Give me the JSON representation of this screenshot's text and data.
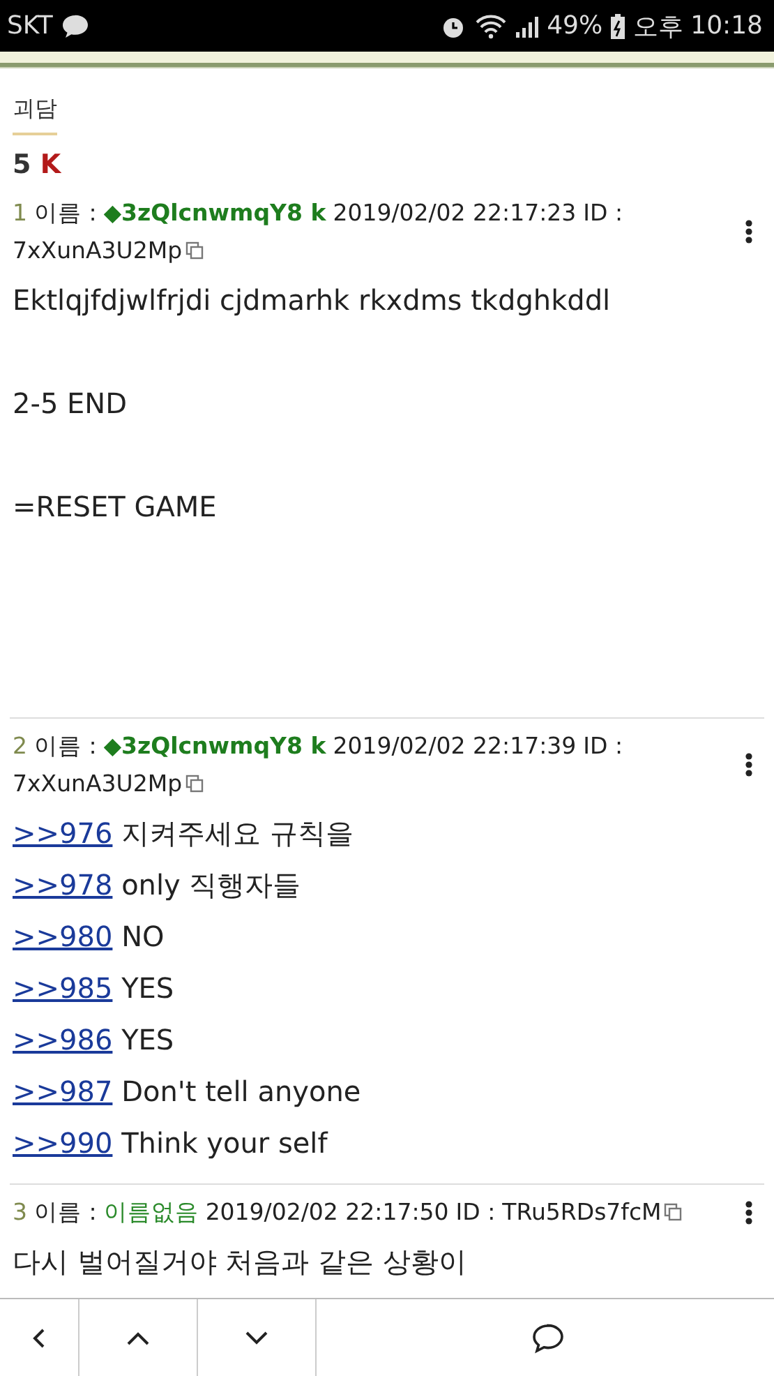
{
  "status_bar": {
    "carrier": "SKT",
    "battery": "49%",
    "ampm": "오후",
    "time": "10:18"
  },
  "board": {
    "title": "괴담"
  },
  "thread": {
    "number": "5",
    "title": "K"
  },
  "posts": [
    {
      "number": "1",
      "name_label": "이름 :",
      "name": "◆3zQlcnwmqY8 k",
      "trip": true,
      "date": "2019/02/02 22:17:23",
      "id_label": "ID :",
      "id": "7xXunA3U2Mp",
      "lines": [
        {
          "text": "Ektlqjfdjwlfrjdi cjdmarhk rkxdms tkdghkddl"
        },
        {
          "text": "2-5 END"
        },
        {
          "text": "=RESET GAME"
        }
      ]
    },
    {
      "number": "2",
      "name_label": "이름 :",
      "name": "◆3zQlcnwmqY8 k",
      "trip": true,
      "date": "2019/02/02 22:17:39",
      "id_label": "ID :",
      "id": "7xXunA3U2Mp",
      "lines": [
        {
          "anchor": ">>976",
          "text": "지켜주세요 규칙을"
        },
        {
          "anchor": ">>978",
          "text": "only 직행자들"
        },
        {
          "anchor": ">>980",
          "text": "NO"
        },
        {
          "anchor": ">>985",
          "text": "YES"
        },
        {
          "anchor": ">>986",
          "text": "YES"
        },
        {
          "anchor": ">>987",
          "text": "Don't tell anyone"
        },
        {
          "anchor": ">>990",
          "text": "Think your self"
        }
      ]
    },
    {
      "number": "3",
      "name_label": "이름 :",
      "name": "이름없음",
      "trip": false,
      "date": "2019/02/02 22:17:50",
      "id_label": "ID :",
      "id": "TRu5RDs7fcM",
      "lines": [
        {
          "text": "다시 벌어질거야 처음과 같은 상황이"
        }
      ]
    }
  ]
}
